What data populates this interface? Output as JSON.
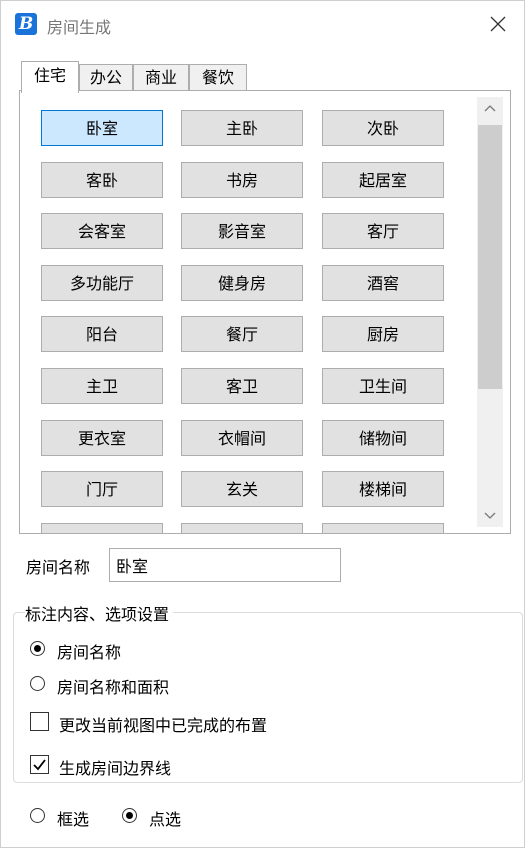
{
  "window": {
    "title": "房间生成"
  },
  "tabs": [
    {
      "label": "住宅",
      "active": true
    },
    {
      "label": "办公",
      "active": false
    },
    {
      "label": "商业",
      "active": false
    },
    {
      "label": "餐饮",
      "active": false
    }
  ],
  "rooms": [
    [
      "卧室",
      "主卧",
      "次卧"
    ],
    [
      "客卧",
      "书房",
      "起居室"
    ],
    [
      "会客室",
      "影音室",
      "客厅"
    ],
    [
      "多功能厅",
      "健身房",
      "酒窖"
    ],
    [
      "阳台",
      "餐厅",
      "厨房"
    ],
    [
      "主卫",
      "客卫",
      "卫生间"
    ],
    [
      "更衣室",
      "衣帽间",
      "储物间"
    ],
    [
      "门厅",
      "玄关",
      "楼梯间"
    ]
  ],
  "selected_room": "卧室",
  "room_name": {
    "label": "房间名称",
    "value": "卧室"
  },
  "annotation": {
    "group_title": "标注内容、选项设置",
    "radio_name": "房间名称",
    "radio_name_area": "房间名称和面积",
    "checkbox_update": "更改当前视图中已完成的布置",
    "checkbox_boundary": "生成房间边界线"
  },
  "select_mode": {
    "box": "框选",
    "point": "点选"
  }
}
